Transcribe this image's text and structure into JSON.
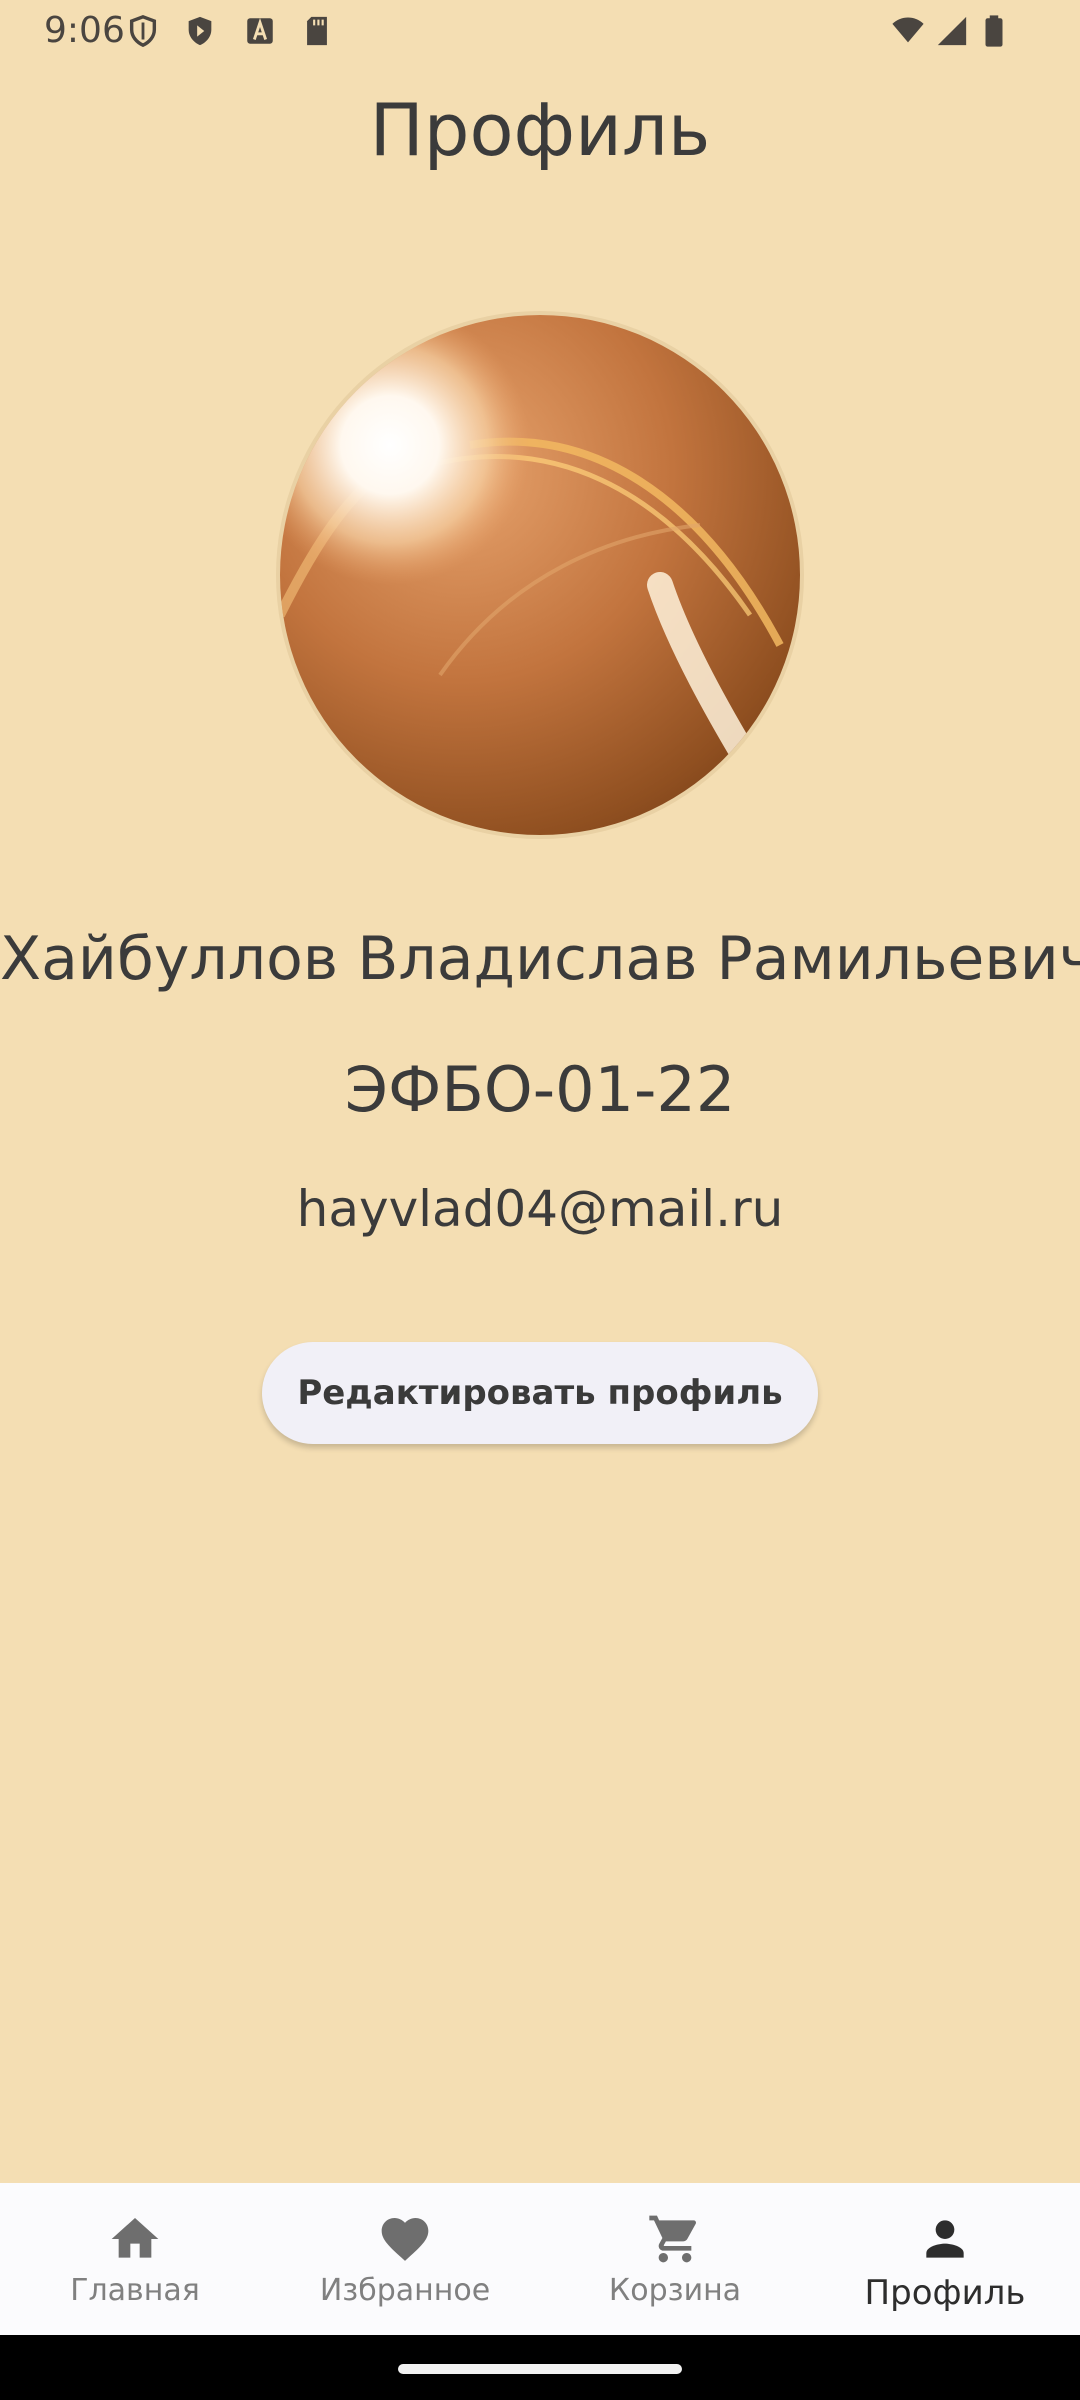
{
  "status_bar": {
    "time": "9:06",
    "left_icons": [
      "shield-outline-icon",
      "shield-play-icon",
      "font-a-icon",
      "sd-card-icon"
    ],
    "right_icons": [
      "wifi-icon",
      "cell-signal-icon",
      "battery-icon"
    ]
  },
  "header": {
    "title": "Профиль"
  },
  "profile": {
    "full_name": "Хайбуллов Владислав Рамильевич",
    "group": "ЭФБО-01-22",
    "email": "hayvlad04@mail.ru",
    "edit_button_label": "Редактировать профиль"
  },
  "bottom_nav": {
    "items": [
      {
        "label": "Главная",
        "icon": "home-icon",
        "active": false
      },
      {
        "label": "Избранное",
        "icon": "heart-icon",
        "active": false
      },
      {
        "label": "Корзина",
        "icon": "cart-icon",
        "active": false
      },
      {
        "label": "Профиль",
        "icon": "person-icon",
        "active": true
      }
    ]
  },
  "colors": {
    "background": "#f4deb3",
    "text": "#3b3b3b",
    "button_bg": "#f1f0f7",
    "nav_bg": "#fbfbfd",
    "nav_inactive": "#808080",
    "nav_active": "#2d2d2d"
  }
}
